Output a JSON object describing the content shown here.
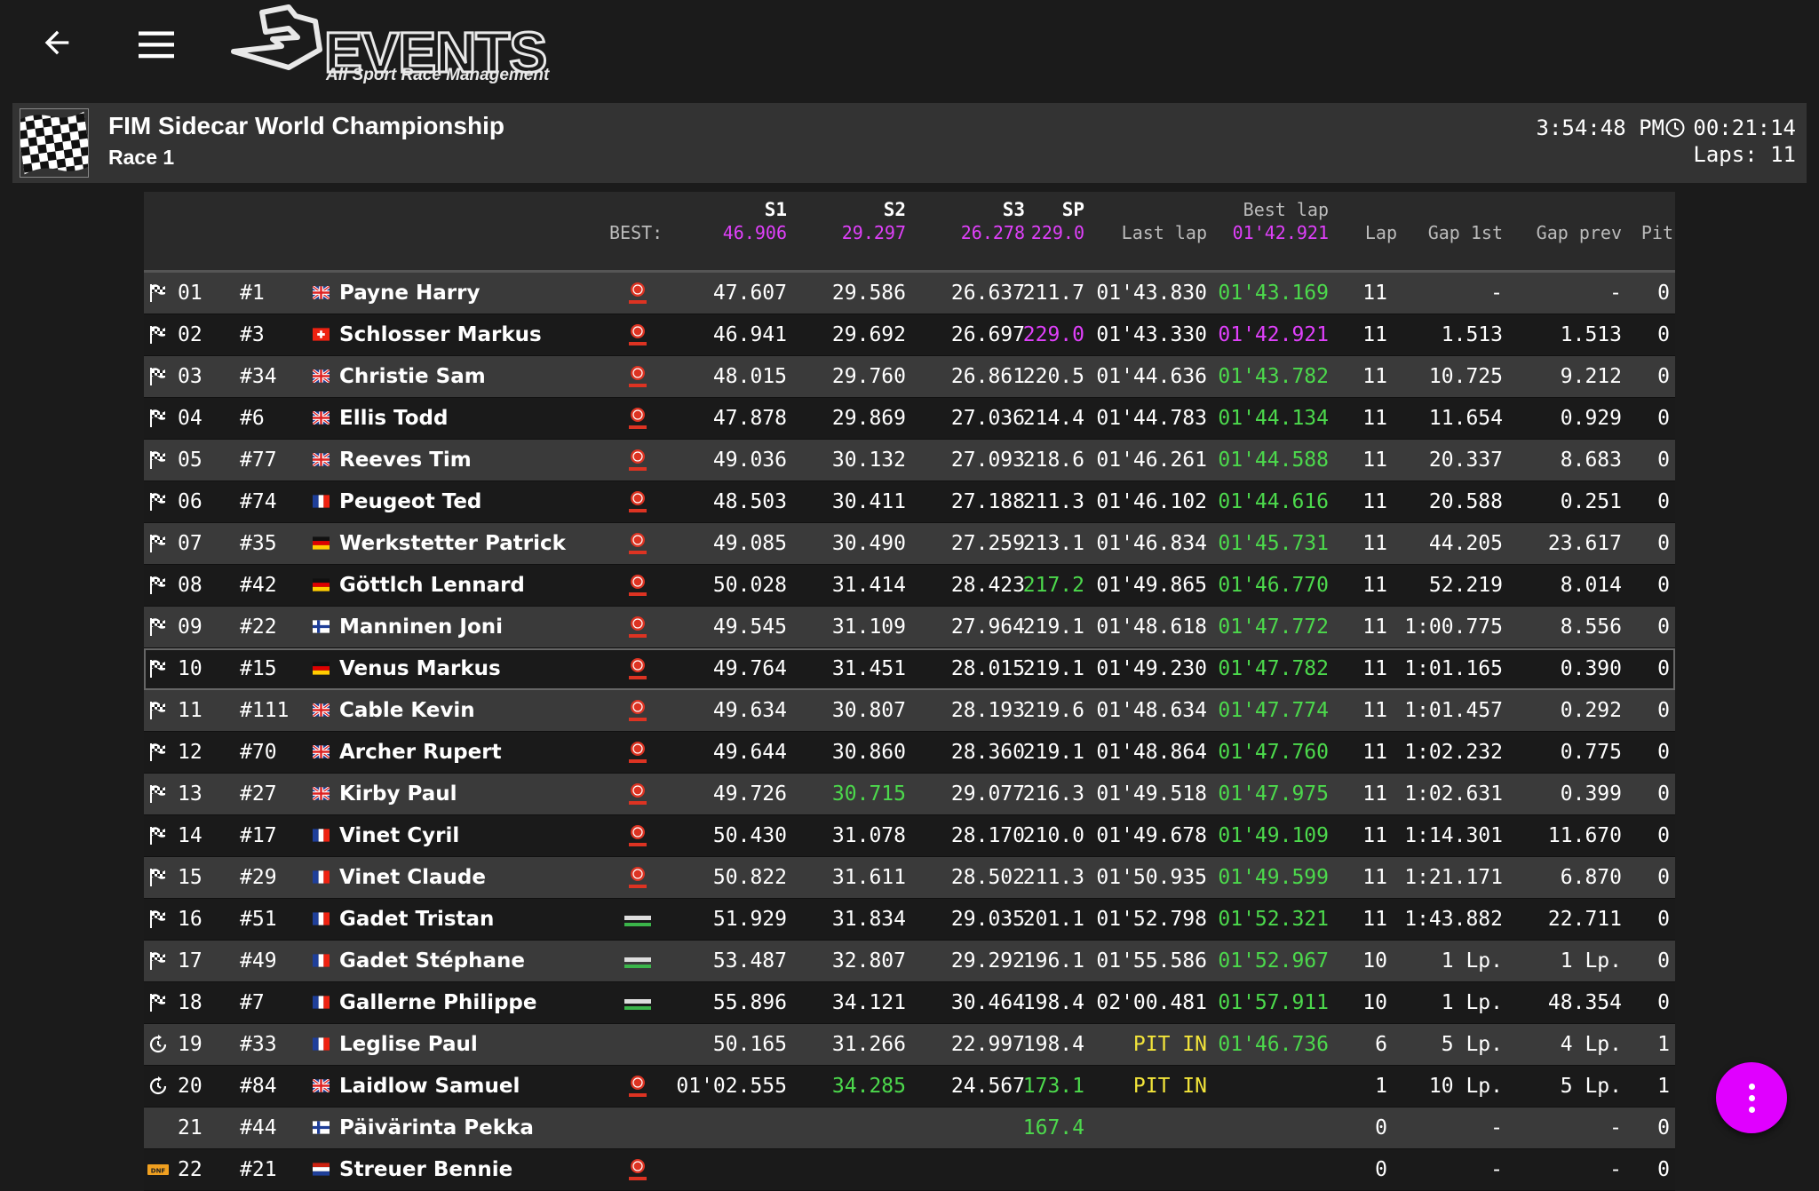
{
  "app": {
    "logo_text": "EVENTS",
    "logo_sub": "All Sport Race Management"
  },
  "event": {
    "title": "FIM Sidecar World Championship",
    "session": "Race 1",
    "clock": "3:54:48 PM",
    "elapsed": "00:21:14",
    "laps": "Laps: 11"
  },
  "columns": {
    "best_label": "BEST:",
    "s1": "S1",
    "s2": "S2",
    "s3": "S3",
    "sp": "SP",
    "best_lap": "Best lap",
    "last_lap": "Last lap",
    "lap": "Lap",
    "gap_1st": "Gap 1st",
    "gap_prev": "Gap prev",
    "pit": "Pit"
  },
  "best": {
    "s1": "46.906",
    "s2": "29.297",
    "s3": "26.278",
    "sp": "229.0",
    "lap": "01'42.921"
  },
  "colors": {
    "personal_best": "#4cd94c",
    "overall_best": "#e040fb",
    "pit": "#f2e43a",
    "fab": "#e000ff"
  },
  "rows": [
    {
      "pos": "01",
      "num": "#1",
      "nat": "gb",
      "name": "Payne Harry",
      "mfr": "yamaha",
      "s1": "47.607",
      "s2": "29.586",
      "s3": "26.637",
      "sp": "211.7",
      "last": "01'43.830",
      "best": "01'43.169",
      "lap": "11",
      "gap1": "-",
      "gapp": "-",
      "pit": "0",
      "icon": "flag"
    },
    {
      "pos": "02",
      "num": "#3",
      "nat": "ch",
      "name": "Schlosser Markus",
      "mfr": "yamaha",
      "s1": "46.941",
      "s2": "29.692",
      "s3": "26.697",
      "sp": "229.0",
      "last": "01'43.330",
      "best": "01'42.921",
      "lap": "11",
      "gap1": "1.513",
      "gapp": "1.513",
      "pit": "0",
      "icon": "flag",
      "sp_c": "m",
      "best_c": "m"
    },
    {
      "pos": "03",
      "num": "#34",
      "nat": "gb",
      "name": "Christie Sam",
      "mfr": "yamaha",
      "s1": "48.015",
      "s2": "29.760",
      "s3": "26.861",
      "sp": "220.5",
      "last": "01'44.636",
      "best": "01'43.782",
      "lap": "11",
      "gap1": "10.725",
      "gapp": "9.212",
      "pit": "0",
      "icon": "flag"
    },
    {
      "pos": "04",
      "num": "#6",
      "nat": "gb",
      "name": "Ellis Todd",
      "mfr": "yamaha",
      "s1": "47.878",
      "s2": "29.869",
      "s3": "27.036",
      "sp": "214.4",
      "last": "01'44.783",
      "best": "01'44.134",
      "lap": "11",
      "gap1": "11.654",
      "gapp": "0.929",
      "pit": "0",
      "icon": "flag"
    },
    {
      "pos": "05",
      "num": "#77",
      "nat": "gb",
      "name": "Reeves Tim",
      "mfr": "yamaha",
      "s1": "49.036",
      "s2": "30.132",
      "s3": "27.093",
      "sp": "218.6",
      "last": "01'46.261",
      "best": "01'44.588",
      "lap": "11",
      "gap1": "20.337",
      "gapp": "8.683",
      "pit": "0",
      "icon": "flag"
    },
    {
      "pos": "06",
      "num": "#74",
      "nat": "fr",
      "name": "Peugeot Ted",
      "mfr": "yamaha",
      "s1": "48.503",
      "s2": "30.411",
      "s3": "27.188",
      "sp": "211.3",
      "last": "01'46.102",
      "best": "01'44.616",
      "lap": "11",
      "gap1": "20.588",
      "gapp": "0.251",
      "pit": "0",
      "icon": "flag"
    },
    {
      "pos": "07",
      "num": "#35",
      "nat": "de",
      "name": "Werkstetter Patrick",
      "mfr": "yamaha",
      "s1": "49.085",
      "s2": "30.490",
      "s3": "27.259",
      "sp": "213.1",
      "last": "01'46.834",
      "best": "01'45.731",
      "lap": "11",
      "gap1": "44.205",
      "gapp": "23.617",
      "pit": "0",
      "icon": "flag"
    },
    {
      "pos": "08",
      "num": "#42",
      "nat": "de",
      "name": "Göttlch Lennard",
      "mfr": "yamaha",
      "s1": "50.028",
      "s2": "31.414",
      "s3": "28.423",
      "sp": "217.2",
      "last": "01'49.865",
      "best": "01'46.770",
      "lap": "11",
      "gap1": "52.219",
      "gapp": "8.014",
      "pit": "0",
      "icon": "flag",
      "sp_c": "g"
    },
    {
      "pos": "09",
      "num": "#22",
      "nat": "fi",
      "name": "Manninen Joni",
      "mfr": "yamaha",
      "s1": "49.545",
      "s2": "31.109",
      "s3": "27.964",
      "sp": "219.1",
      "last": "01'48.618",
      "best": "01'47.772",
      "lap": "11",
      "gap1": "1:00.775",
      "gapp": "8.556",
      "pit": "0",
      "icon": "flag"
    },
    {
      "pos": "10",
      "num": "#15",
      "nat": "de",
      "name": "Venus Markus",
      "mfr": "yamaha",
      "s1": "49.764",
      "s2": "31.451",
      "s3": "28.015",
      "sp": "219.1",
      "last": "01'49.230",
      "best": "01'47.782",
      "lap": "11",
      "gap1": "1:01.165",
      "gapp": "0.390",
      "pit": "0",
      "icon": "flag",
      "sel": true
    },
    {
      "pos": "11",
      "num": "#111",
      "nat": "gb",
      "name": "Cable Kevin",
      "mfr": "yamaha",
      "s1": "49.634",
      "s2": "30.807",
      "s3": "28.193",
      "sp": "219.6",
      "last": "01'48.634",
      "best": "01'47.774",
      "lap": "11",
      "gap1": "1:01.457",
      "gapp": "0.292",
      "pit": "0",
      "icon": "flag"
    },
    {
      "pos": "12",
      "num": "#70",
      "nat": "gb",
      "name": "Archer Rupert",
      "mfr": "yamaha",
      "s1": "49.644",
      "s2": "30.860",
      "s3": "28.360",
      "sp": "219.1",
      "last": "01'48.864",
      "best": "01'47.760",
      "lap": "11",
      "gap1": "1:02.232",
      "gapp": "0.775",
      "pit": "0",
      "icon": "flag"
    },
    {
      "pos": "13",
      "num": "#27",
      "nat": "gb",
      "name": "Kirby Paul",
      "mfr": "yamaha",
      "s1": "49.726",
      "s2": "30.715",
      "s3": "29.077",
      "sp": "216.3",
      "last": "01'49.518",
      "best": "01'47.975",
      "lap": "11",
      "gap1": "1:02.631",
      "gapp": "0.399",
      "pit": "0",
      "icon": "flag",
      "s2_c": "g"
    },
    {
      "pos": "14",
      "num": "#17",
      "nat": "fr",
      "name": "Vinet Cyril",
      "mfr": "yamaha",
      "s1": "50.430",
      "s2": "31.078",
      "s3": "28.170",
      "sp": "210.0",
      "last": "01'49.678",
      "best": "01'49.109",
      "lap": "11",
      "gap1": "1:14.301",
      "gapp": "11.670",
      "pit": "0",
      "icon": "flag"
    },
    {
      "pos": "15",
      "num": "#29",
      "nat": "fr",
      "name": "Vinet Claude",
      "mfr": "yamaha",
      "s1": "50.822",
      "s2": "31.611",
      "s3": "28.502",
      "sp": "211.3",
      "last": "01'50.935",
      "best": "01'49.599",
      "lap": "11",
      "gap1": "1:21.171",
      "gapp": "6.870",
      "pit": "0",
      "icon": "flag"
    },
    {
      "pos": "16",
      "num": "#51",
      "nat": "fr",
      "name": "Gadet Tristan",
      "mfr": "kawasaki",
      "s1": "51.929",
      "s2": "31.834",
      "s3": "29.035",
      "sp": "201.1",
      "last": "01'52.798",
      "best": "01'52.321",
      "lap": "11",
      "gap1": "1:43.882",
      "gapp": "22.711",
      "pit": "0",
      "icon": "flag"
    },
    {
      "pos": "17",
      "num": "#49",
      "nat": "fr",
      "name": "Gadet Stéphane",
      "mfr": "kawasaki",
      "s1": "53.487",
      "s2": "32.807",
      "s3": "29.292",
      "sp": "196.1",
      "last": "01'55.586",
      "best": "01'52.967",
      "lap": "10",
      "gap1": "1 Lp.",
      "gapp": "1 Lp.",
      "pit": "0",
      "icon": "flag"
    },
    {
      "pos": "18",
      "num": "#7",
      "nat": "fr",
      "name": "Gallerne Philippe",
      "mfr": "kawasaki",
      "s1": "55.896",
      "s2": "34.121",
      "s3": "30.464",
      "sp": "198.4",
      "last": "02'00.481",
      "best": "01'57.911",
      "lap": "10",
      "gap1": "1 Lp.",
      "gapp": "48.354",
      "pit": "0",
      "icon": "flag"
    },
    {
      "pos": "19",
      "num": "#33",
      "nat": "fr",
      "name": "Leglise Paul",
      "mfr": "",
      "s1": "50.165",
      "s2": "31.266",
      "s3": "22.997",
      "sp": "198.4",
      "last": "PIT IN",
      "best": "01'46.736",
      "lap": "6",
      "gap1": "5 Lp.",
      "gapp": "4 Lp.",
      "pit": "1",
      "icon": "pit",
      "last_c": "y"
    },
    {
      "pos": "20",
      "num": "#84",
      "nat": "gb",
      "name": "Laidlow Samuel",
      "mfr": "yamaha",
      "s1": "01'02.555",
      "s2": "34.285",
      "s3": "24.567",
      "sp": "173.1",
      "last": "PIT IN",
      "best": "",
      "lap": "1",
      "gap1": "10 Lp.",
      "gapp": "5 Lp.",
      "pit": "1",
      "icon": "pit",
      "s2_c": "g",
      "sp_c": "g",
      "last_c": "y"
    },
    {
      "pos": "21",
      "num": "#44",
      "nat": "fi",
      "name": "Päivärinta Pekka",
      "mfr": "",
      "s1": "",
      "s2": "",
      "s3": "",
      "sp": "167.4",
      "last": "",
      "best": "",
      "lap": "0",
      "gap1": "-",
      "gapp": "-",
      "pit": "0",
      "icon": "",
      "sp_c": "g"
    },
    {
      "pos": "22",
      "num": "#21",
      "nat": "nl",
      "name": "Streuer Bennie",
      "mfr": "yamaha",
      "s1": "",
      "s2": "",
      "s3": "",
      "sp": "",
      "last": "",
      "best": "",
      "lap": "0",
      "gap1": "-",
      "gapp": "-",
      "pit": "0",
      "icon": "dnf"
    }
  ]
}
